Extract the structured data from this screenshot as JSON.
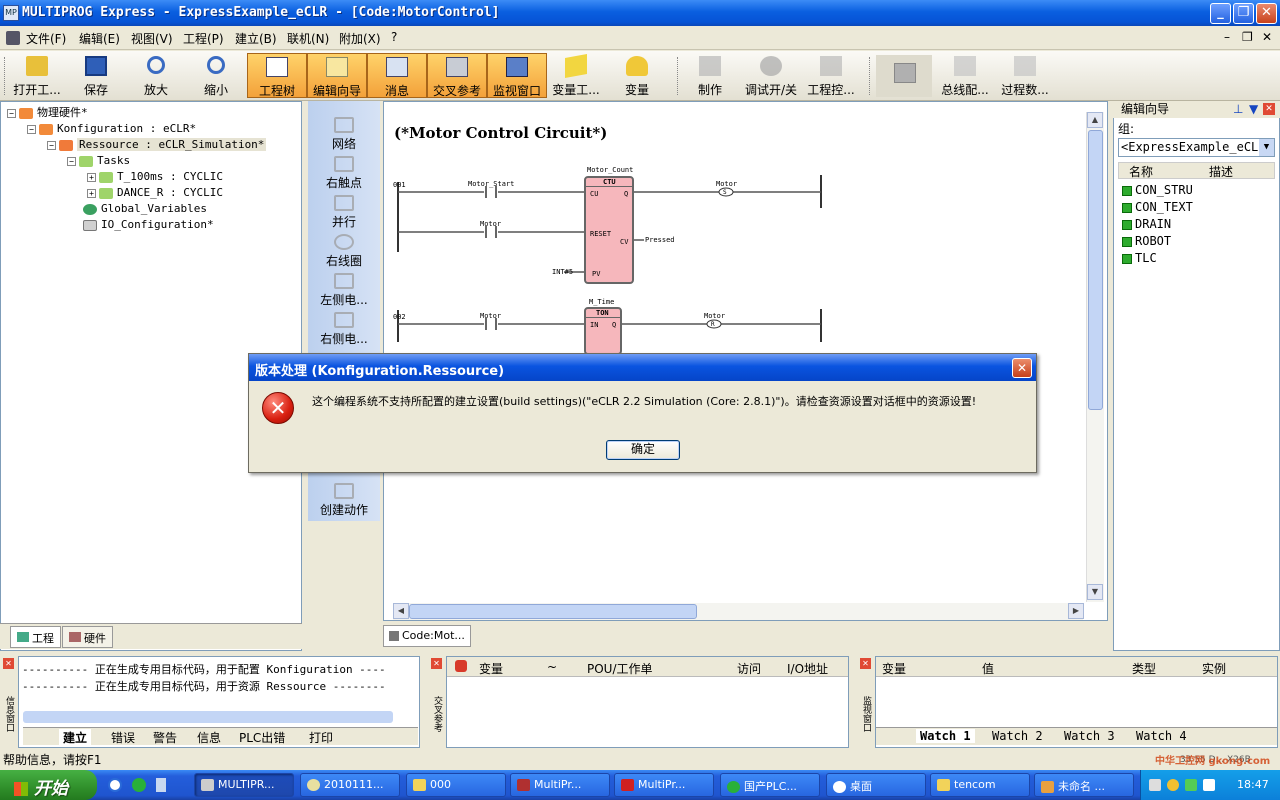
{
  "window": {
    "title": "MULTIPROG Express - ExpressExample_eCLR - [Code:MotorControl]",
    "app_icon": "MP"
  },
  "menu": [
    "文件(F)",
    "编辑(E)",
    "视图(V)",
    "工程(P)",
    "建立(B)",
    "联机(N)",
    "附加(X)",
    "?"
  ],
  "toolbar": [
    {
      "label": "打开工...",
      "icon": "open-project-icon",
      "active": false
    },
    {
      "label": "保存",
      "icon": "save-icon",
      "active": false
    },
    {
      "label": "放大",
      "icon": "zoom-in-icon",
      "active": false
    },
    {
      "label": "缩小",
      "icon": "zoom-out-icon",
      "active": false
    },
    {
      "label": "工程树",
      "icon": "project-tree-icon",
      "active": true
    },
    {
      "label": "编辑向导",
      "icon": "edit-wizard-icon",
      "active": true
    },
    {
      "label": "消息",
      "icon": "message-icon",
      "active": true
    },
    {
      "label": "交叉参考",
      "icon": "cross-reference-icon",
      "active": true
    },
    {
      "label": "监视窗口",
      "icon": "watch-window-icon",
      "active": true
    },
    {
      "label": "变量工...",
      "icon": "variable-tool-icon",
      "active": false
    },
    {
      "label": "变量",
      "icon": "variable-icon",
      "active": false
    },
    {
      "label": "制作",
      "icon": "make-icon",
      "active": false
    },
    {
      "label": "调试开/关",
      "icon": "debug-toggle-icon",
      "active": false
    },
    {
      "label": "工程控...",
      "icon": "project-control-icon",
      "active": false
    },
    {
      "label": "总线配...",
      "icon": "bus-config-icon",
      "active": false
    },
    {
      "label": "过程数...",
      "icon": "process-data-icon",
      "active": false
    }
  ],
  "tree": {
    "root": "物理硬件*",
    "konfiguration": "Konfiguration : eCLR*",
    "ressource": "Ressource : eCLR_Simulation*",
    "tasks": "Tasks",
    "task1": "T_100ms : CYCLIC",
    "task2": "DANCE_R : CYCLIC",
    "globals": "Global_Variables",
    "io": "IO_Configuration*",
    "tab_project": "工程",
    "tab_hardware": "硬件"
  },
  "palette": [
    "网络",
    "右触点",
    "并行",
    "右线圈",
    "左侧电...",
    "右侧电...",
    "创建动作"
  ],
  "editor": {
    "title": "(*Motor Control Circuit*)",
    "tab": "Code:Mot...",
    "net1": "001",
    "net2": "002",
    "fb1_name": "Motor_Count",
    "fb1_type": "CTU",
    "fb1_pins": {
      "cu": "CU",
      "q": "Q",
      "reset": "RESET",
      "cv": "CV",
      "pv": "PV"
    },
    "fb1_pv_in": "INT#5",
    "fb1_cv_out": "Pressed",
    "contact_start": "Motor_Start",
    "contact_motor": "Motor",
    "coil_motor1": "Motor",
    "coil_sym1": "S",
    "fb2_name": "M_Time",
    "fb2_type": "TON",
    "fb2_pins": {
      "in": "IN",
      "q": "Q"
    },
    "contact_motor2": "Motor",
    "coil_motor2": "Motor",
    "coil_sym2": "R"
  },
  "right_panel": {
    "title": "编辑向导",
    "group_label": "组:",
    "group_value": "<ExpressExample_eCL",
    "col_name": "名称",
    "col_desc": "描述",
    "items": [
      "CON_STRU",
      "CON_TEXT",
      "DRAIN",
      "ROBOT",
      "TLC"
    ]
  },
  "messages": {
    "lines": [
      "---------- 正在生成专用目标代码，用于配置 Konfiguration ----",
      "---------- 正在生成专用目标代码，用于资源 Ressource --------"
    ],
    "tabs": [
      "建立",
      "错误",
      "警告",
      "信息",
      "PLC出错",
      "打印"
    ],
    "side_label": "信息窗口"
  },
  "crossref": {
    "columns": [
      "变量",
      "~",
      "POU/工作单",
      "访问",
      "I/O地址"
    ],
    "side_label": "交叉参考"
  },
  "watch": {
    "columns": [
      "变量",
      "值",
      "类型",
      "实例"
    ],
    "tabs": [
      "Watch 1",
      "Watch 2",
      "Watch 3",
      "Watch 4"
    ],
    "side_label": "监视窗口"
  },
  "statusbar": {
    "text": "帮助信息，请按F1",
    "right": "33 55 D... X26B"
  },
  "dialog": {
    "title": "版本处理 (Konfiguration.Ressource)",
    "message": "这个编程系统不支持所配置的建立设置(build settings)(\"eCLR 2.2 Simulation (Core: 2.8.1)\")。请检查资源设置对话框中的资源设置!",
    "ok_label": "确定",
    "icon": "error-icon"
  },
  "taskbar": {
    "start": "开始",
    "tasks": [
      "MULTIPR...",
      "2010111...",
      "000",
      "MultiPr...",
      "MultiPr...",
      "国产PLC...",
      "桌面",
      "tencom",
      "未命名 ..."
    ],
    "clock": "18:47",
    "watermark": "中华工控网 gkong.com"
  },
  "colors": {
    "titlebar": "#0a5fe0",
    "toolbar_active": "#f3a13a",
    "fb_fill": "#f6b7bc",
    "dialog_title": "#0a54e0",
    "start": "#308f2b"
  }
}
